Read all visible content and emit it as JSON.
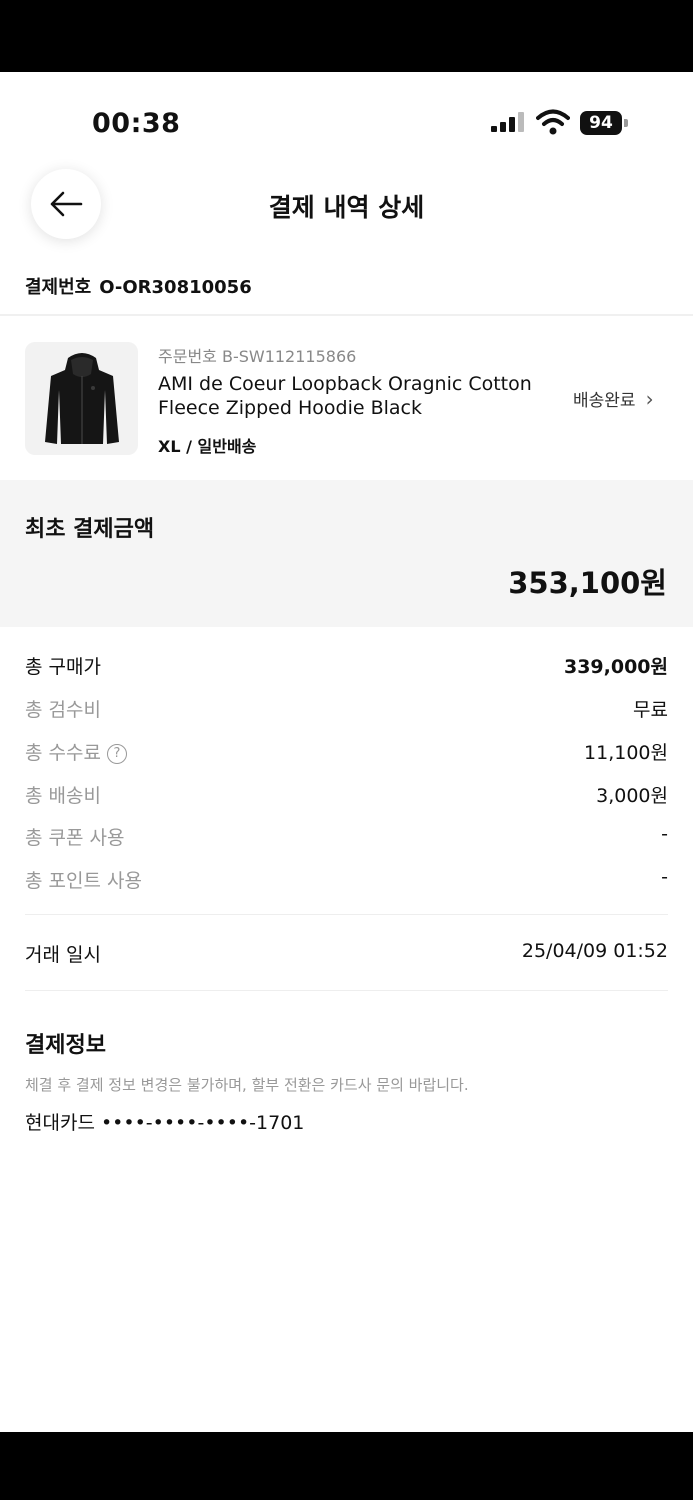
{
  "status_bar": {
    "time": "00:38",
    "battery": "94"
  },
  "header": {
    "title": "결제 내역 상세"
  },
  "payment_number": {
    "label": "결제번호",
    "value": "O-OR30810056"
  },
  "product": {
    "order_number": "주문번호 B-SW112115866",
    "name": "AMI de Coeur Loopback Oragnic Cotton Fleece Zipped Hoodie Black",
    "option": "XL / 일반배송",
    "status": "배송완료",
    "image_icon": "hoodie-image"
  },
  "initial_payment": {
    "label": "최초 결제금액",
    "amount": "353,100원"
  },
  "breakdown": [
    {
      "label": "총 구매가",
      "value": "339,000원"
    },
    {
      "label": "총 검수비",
      "value": "무료"
    },
    {
      "label": "총 수수료",
      "value": "11,100원"
    },
    {
      "label": "총 배송비",
      "value": "3,000원"
    },
    {
      "label": "총 쿠폰 사용",
      "value": "-"
    },
    {
      "label": "총 포인트 사용",
      "value": "-"
    }
  ],
  "transaction": {
    "label": "거래 일시",
    "value": "25/04/09 01:52"
  },
  "payment_info": {
    "title": "결제정보",
    "notice": "체결 후 결제 정보 변경은 불가하며, 할부 전환은 카드사 문의 바랍니다.",
    "card": "현대카드 ••••-••••-••••-1701"
  }
}
